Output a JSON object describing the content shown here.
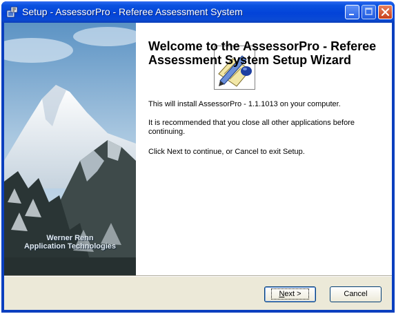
{
  "window": {
    "title": "Setup - AssessorPro - Referee Assessment System",
    "minimize_icon": "minimize-icon",
    "maximize_icon": "maximize-icon",
    "close_icon": "close-icon"
  },
  "banner": {
    "line1": "Werner Renn",
    "line2": "Application Technologies"
  },
  "content": {
    "heading": "Welcome to the AssessorPro - Referee Assessment System Setup Wizard",
    "para1": "This will install AssessorPro - 1.1.1013 on your computer.",
    "para2": "It is recommended that you close all other applications before continuing.",
    "para3": "Click Next to continue, or Cancel to exit Setup."
  },
  "buttons": {
    "next_label": "Next >",
    "next_mnemonic": "N",
    "next_rest": "ext >",
    "cancel_label": "Cancel"
  },
  "colors": {
    "titlebar": "#0343d8",
    "dialog_bg": "#ece9d8",
    "close_button": "#c8401c"
  }
}
